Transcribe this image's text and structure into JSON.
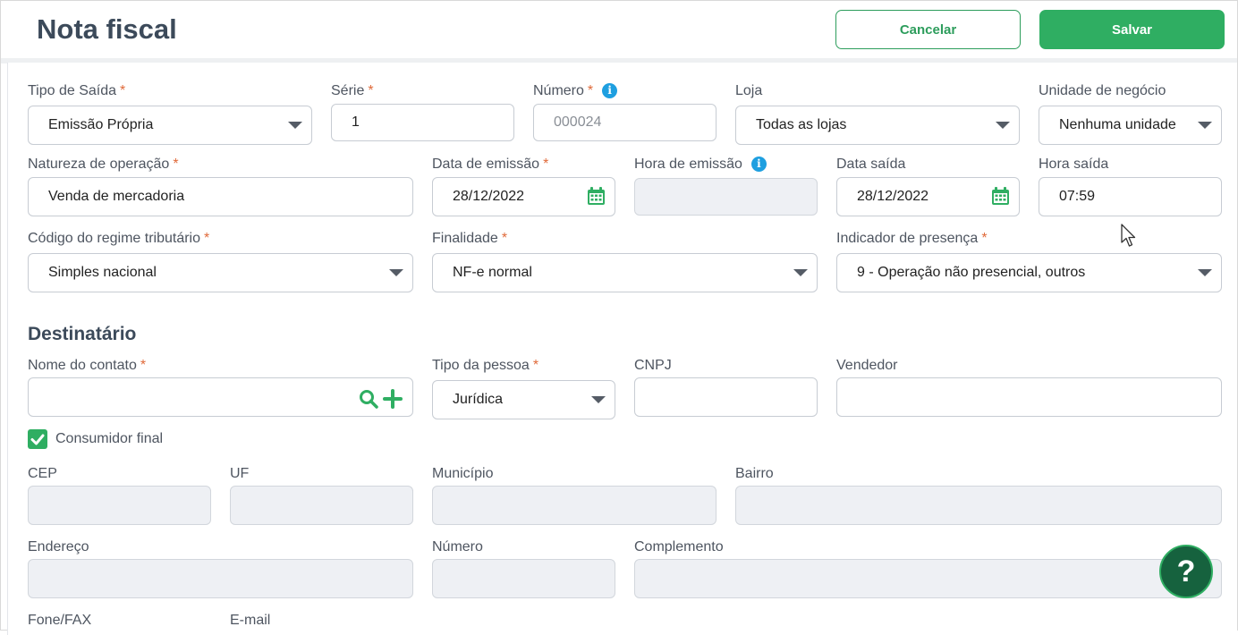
{
  "header": {
    "title": "Nota fiscal",
    "cancel_label": "Cancelar",
    "save_label": "Salvar"
  },
  "required_mark": "*",
  "fields": {
    "tipo_saida": {
      "label": "Tipo de Saída",
      "value": "Emissão Própria"
    },
    "serie": {
      "label": "Série",
      "value": "1"
    },
    "numero": {
      "label": "Número",
      "placeholder": "000024"
    },
    "loja": {
      "label": "Loja",
      "value": "Todas as lojas"
    },
    "unidade_negocio": {
      "label": "Unidade de negócio",
      "value": "Nenhuma unidade"
    },
    "natureza_operacao": {
      "label": "Natureza de operação",
      "value": "Venda de mercadoria"
    },
    "data_emissao": {
      "label": "Data de emissão",
      "value": "28/12/2022"
    },
    "hora_emissao": {
      "label": "Hora de emissão",
      "value": ""
    },
    "data_saida": {
      "label": "Data saída",
      "value": "28/12/2022"
    },
    "hora_saida": {
      "label": "Hora saída",
      "value": "07:59"
    },
    "regime_tributario": {
      "label": "Código do regime tributário",
      "value": "Simples nacional"
    },
    "finalidade": {
      "label": "Finalidade",
      "value": "NF-e normal"
    },
    "indicador_presenca": {
      "label": "Indicador de presença",
      "value": "9 - Operação não presencial, outros"
    }
  },
  "destinatario": {
    "section_title": "Destinatário",
    "nome_contato": {
      "label": "Nome do contato",
      "value": ""
    },
    "tipo_pessoa": {
      "label": "Tipo da pessoa",
      "value": "Jurídica"
    },
    "cnpj": {
      "label": "CNPJ",
      "value": ""
    },
    "vendedor": {
      "label": "Vendedor",
      "value": ""
    },
    "consumidor_final": {
      "label": "Consumidor final",
      "checked": true
    },
    "cep": {
      "label": "CEP"
    },
    "uf": {
      "label": "UF"
    },
    "municipio": {
      "label": "Município"
    },
    "bairro": {
      "label": "Bairro"
    },
    "endereco": {
      "label": "Endereço"
    },
    "numero": {
      "label": "Número"
    },
    "complemento": {
      "label": "Complemento"
    },
    "fone_fax": {
      "label": "Fone/FAX"
    },
    "email": {
      "label": "E-mail"
    }
  },
  "help": {
    "label": "?"
  },
  "colors": {
    "primary": "#2fae62",
    "info": "#1e9fe0",
    "required": "#e06a3a",
    "help_bg": "#16623e"
  },
  "icons": [
    "info-icon",
    "chevron-down-icon",
    "calendar-icon",
    "search-icon",
    "plus-icon",
    "check-icon",
    "help-icon",
    "mouse-cursor-icon"
  ]
}
